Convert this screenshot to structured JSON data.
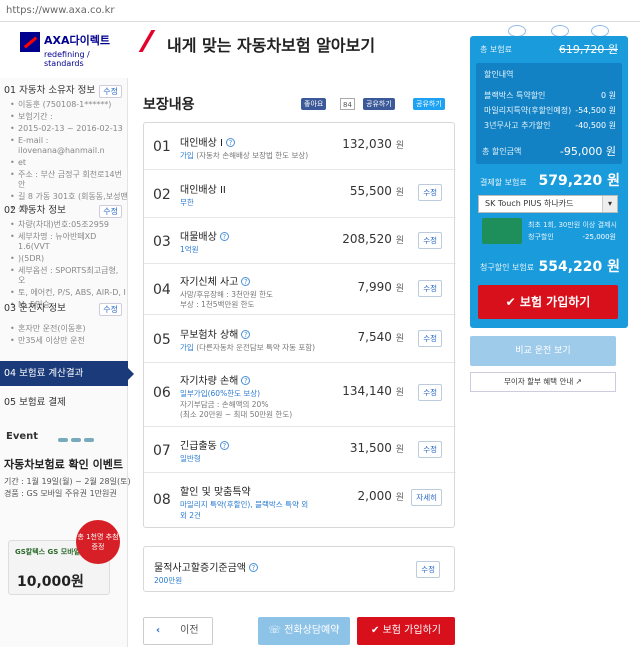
{
  "browser": {
    "url": "https://www.axa.co.kr"
  },
  "brand": {
    "name": "AXA다이렉트",
    "slogan": "redefining / standards"
  },
  "page_title": "내게 맞는 자동차보험 알아보기",
  "sidebar": {
    "sections": [
      {
        "num": "01",
        "title": "자동차 소유자 정보",
        "edit": "수정",
        "items": [
          "이동훈 (750108-1******)",
          "보험기간 :",
          "2015-02-13 ~ 2016-02-13",
          "E-mail : ilovenana@hanmail.n",
          "et",
          "주소 : 부산 금정구 회천로14번안",
          "길 8 가동 301호 (회동동,보성맨",
          "션)"
        ]
      },
      {
        "num": "02",
        "title": "자동차 정보",
        "edit": "수정",
        "items": [
          "차량(차대)번호:05조2959",
          "세부차명 : 뉴아반떼XD 1.6(VVT",
          ")(5DR)",
          "세부옵션 : SPORTS최고급형, 오",
          "토, 에어컨, P/S, ABS, AIR-D, I",
          "M, 5인승"
        ]
      },
      {
        "num": "03",
        "title": "운전자 정보",
        "edit": "수정",
        "items": [
          "혼자만 운전(이동훈)",
          "만35세 이상만 운전"
        ]
      },
      {
        "num": "04",
        "title": "보험료 계산결과"
      },
      {
        "num": "05",
        "title": "보험료 결제"
      }
    ],
    "event": {
      "label": "Event",
      "title": "자동차보험료 확인 이벤트",
      "period": "기간 : 1월 19일(월) ~ 2월 28일(토)",
      "prize": "경품 : GS 모바일 주유권 1만원권",
      "stamp": "총 1천명 추첨증정",
      "card_brand": "GS칼텍스 GS 모바일 주유권",
      "amount": "10,000원"
    }
  },
  "main": {
    "coverage_title": "보장내용",
    "social": {
      "fb_like": "좋아요",
      "fb_count": "84",
      "fb_share": "공유하기",
      "tw_share": "공유하기"
    },
    "rows": [
      {
        "num": "01",
        "name": "대인배상 I",
        "detail_link": "가입",
        "detail": "(자동차 손해배상 보장법 한도 보상)",
        "price": "132,030",
        "unit": "원",
        "action": ""
      },
      {
        "num": "02",
        "name": "대인배상 II",
        "detail_link": "무한",
        "detail": "",
        "price": "55,500",
        "unit": "원",
        "action": "수정"
      },
      {
        "num": "03",
        "name": "대물배상",
        "detail_link": "1억원",
        "detail": "",
        "price": "208,520",
        "unit": "원",
        "action": "수정"
      },
      {
        "num": "04",
        "name": "자기신체 사고",
        "detail_link": "",
        "detail": "사망/후유장해 : 3천만원 한도",
        "detail2": "부상 : 1천5백만원 한도",
        "price": "7,990",
        "unit": "원",
        "action": "수정"
      },
      {
        "num": "05",
        "name": "무보험차 상해",
        "detail_link": "가입",
        "detail": "(다른자동차 운전담보 특약 자동 포함)",
        "price": "7,540",
        "unit": "원",
        "action": "수정"
      },
      {
        "num": "06",
        "name": "자기차량 손해",
        "detail_link": "일부가입(60%한도 보상)",
        "detail": "자기부담금 : 손해액의 20%",
        "detail2": "(최소 20만원 ~ 최대 50만원 한도)",
        "price": "134,140",
        "unit": "원",
        "action": "수정"
      },
      {
        "num": "07",
        "name": "긴급출동",
        "detail_link": "일반형",
        "detail": "",
        "price": "31,500",
        "unit": "원",
        "action": "수정"
      },
      {
        "num": "08",
        "name": "할인 및 맞춤특약",
        "detail_link": "마일리지 특약(후할인), 블랙박스 특약 외",
        "detail_link2": "외 2건",
        "detail": "",
        "price": "2,000",
        "unit": "원",
        "action": "자세히"
      }
    ],
    "extra": {
      "name": "물적사고할증기준금액",
      "value": "200만원",
      "action": "수정"
    },
    "prev_label": "이전",
    "tel_label": "전화상담예약",
    "join_label": "보험 가입하기"
  },
  "right_panel": {
    "premium_label": "총 보험료",
    "premium_value": "619,720 원",
    "discount_header": "할인내역",
    "discounts": [
      {
        "label": "블랙박스 특약할인",
        "value": "0 원"
      },
      {
        "label": "마일리지특약(후할인예정)",
        "value": "-54,500 원"
      },
      {
        "label": "3년무사고 추가할인",
        "value": "-40,500 원"
      }
    ],
    "total_discount_label": "총 할인금액",
    "total_discount_value": "-95,000 원",
    "payment_label": "결제할 보험료",
    "payment_value": "579,220 원",
    "card_select": "SK Touch PIUS 하나카드",
    "card_note1": "최초 1회, 30만원 이상 결제시",
    "card_note2_label": "청구할인",
    "card_note2_value": "-25,000원",
    "final_label": "청구할인 보험료",
    "final_value": "554,220 원",
    "join_label": "보험 가입하기",
    "compare_label": "비교 운전 보기",
    "installment_label": "무이자 할부 혜택 안내"
  }
}
